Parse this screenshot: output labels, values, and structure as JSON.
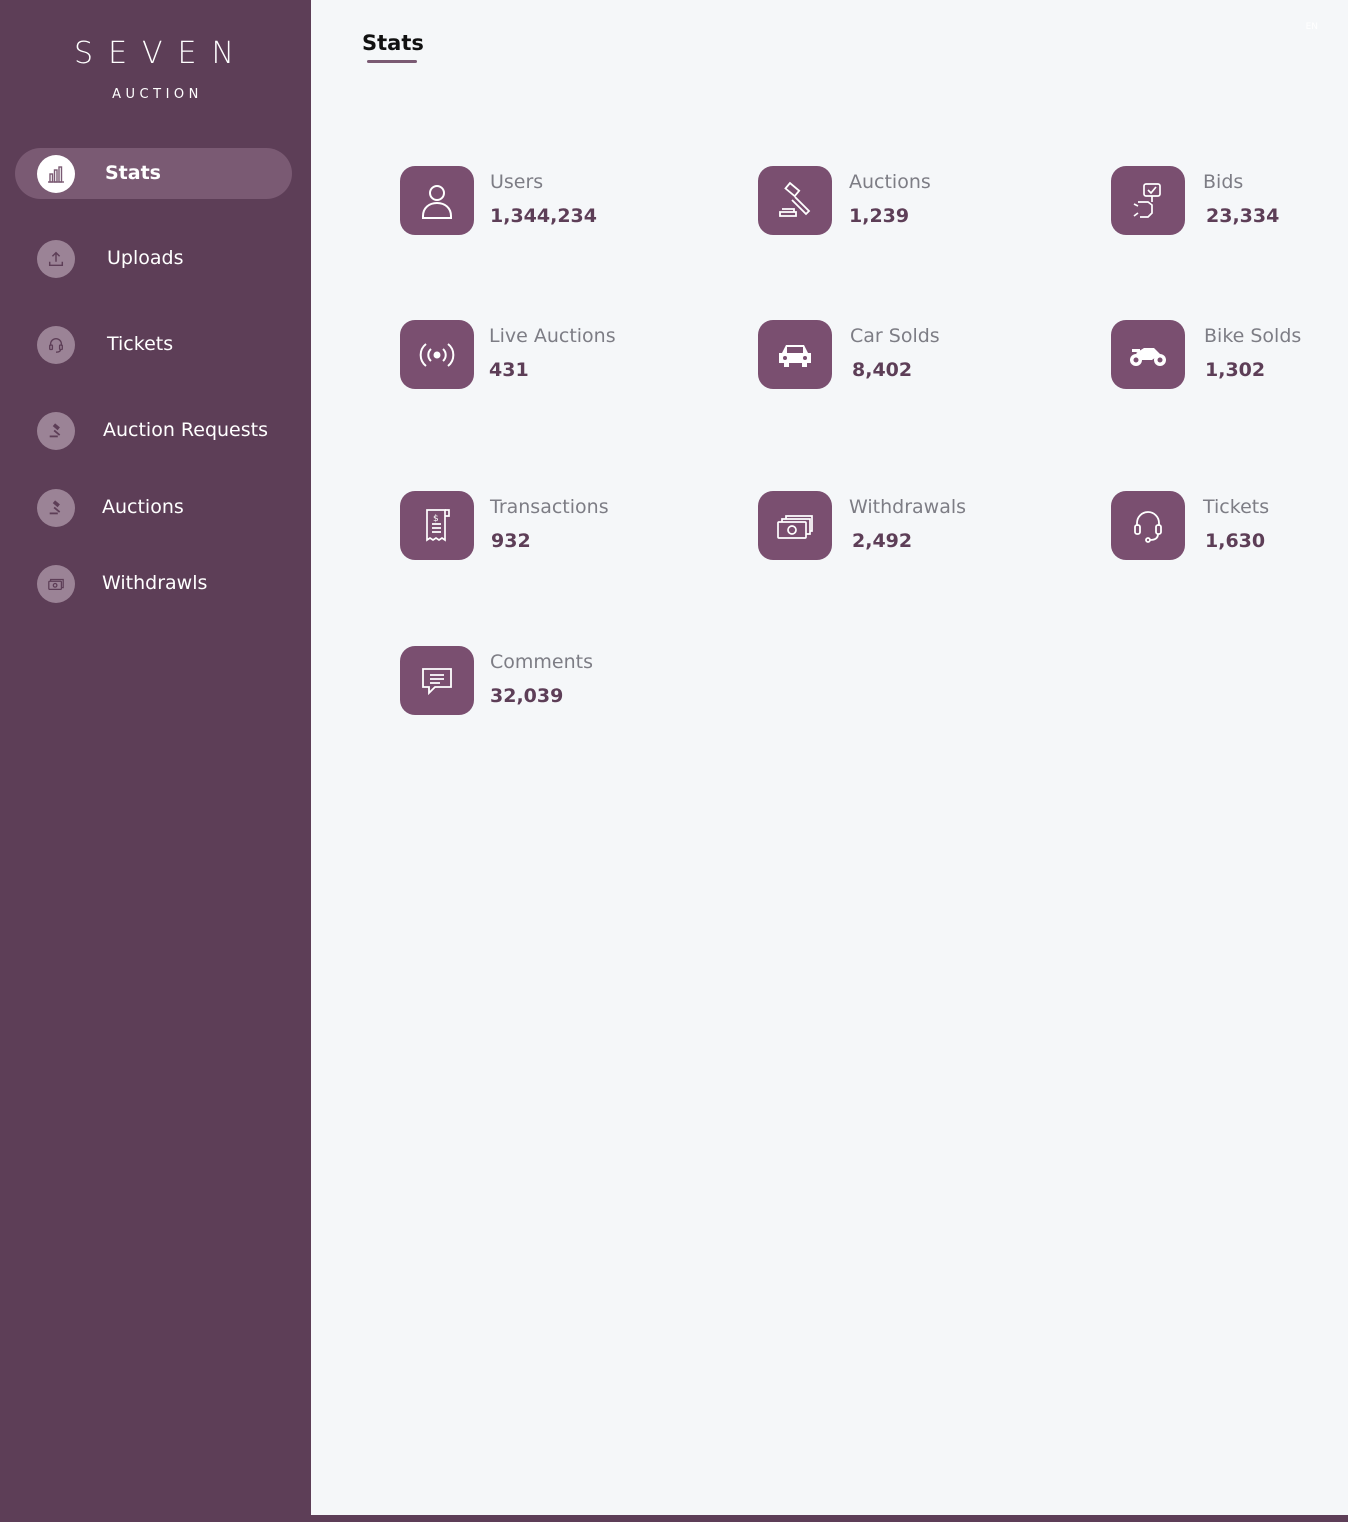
{
  "brand": {
    "name": "SEVEN",
    "sub": "AUCTION"
  },
  "sidebar": {
    "items": [
      {
        "label": "Stats",
        "icon": "bar-chart-icon",
        "active": true
      },
      {
        "label": "Uploads",
        "icon": "upload-icon"
      },
      {
        "label": "Tickets",
        "icon": "headset-icon"
      },
      {
        "label": "Auction Requests",
        "icon": "gavel-icon"
      },
      {
        "label": "Auctions",
        "icon": "gavel-icon"
      },
      {
        "label": "Withdrawls",
        "icon": "money-icon"
      }
    ]
  },
  "header": {
    "title": "Stats",
    "language": "EN"
  },
  "stats": [
    {
      "label": "Users",
      "value": "1,344,234",
      "icon": "user-icon"
    },
    {
      "label": "Auctions",
      "value": "1,239",
      "icon": "gavel-icon"
    },
    {
      "label": "Bids",
      "value": "23,334",
      "icon": "bid-hand-icon"
    },
    {
      "label": "Live Auctions",
      "value": "431",
      "icon": "broadcast-icon"
    },
    {
      "label": "Car Solds",
      "value": "8,402",
      "icon": "car-icon"
    },
    {
      "label": "Bike Solds",
      "value": "1,302",
      "icon": "motorbike-icon"
    },
    {
      "label": "Transactions",
      "value": "932",
      "icon": "receipt-icon"
    },
    {
      "label": "Withdrawals",
      "value": "2,492",
      "icon": "cash-icon"
    },
    {
      "label": "Tickets",
      "value": "1,630",
      "icon": "headset-icon"
    },
    {
      "label": "Comments",
      "value": "32,039",
      "icon": "chat-icon"
    }
  ],
  "colors": {
    "sidebar": "#5d3e57",
    "accent": "#7a4f70",
    "background": "#f5f7f9"
  }
}
